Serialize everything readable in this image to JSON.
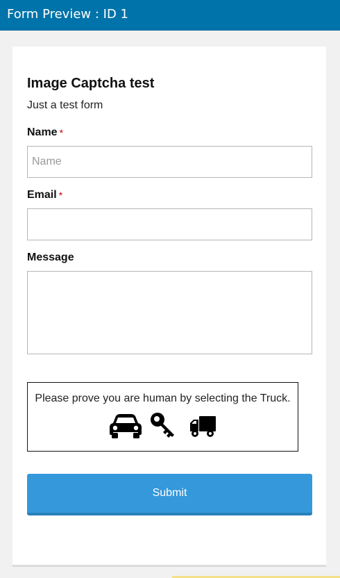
{
  "header": {
    "title": "Form Preview : ID 1"
  },
  "form": {
    "title": "Image Captcha test",
    "description": "Just a test form",
    "name": {
      "label": "Name",
      "required_mark": "*",
      "placeholder": "Name",
      "value": ""
    },
    "email": {
      "label": "Email",
      "required_mark": "*",
      "placeholder": "",
      "value": ""
    },
    "message": {
      "label": "Message",
      "placeholder": "",
      "value": ""
    },
    "captcha": {
      "prompt": "Please prove you are human by selecting the Truck.",
      "options": [
        "car-icon",
        "key-icon",
        "truck-icon"
      ]
    },
    "submit_label": "Submit"
  },
  "colors": {
    "header_bg": "#0073aa",
    "submit_bg": "#3498db",
    "required": "#cc0000"
  }
}
